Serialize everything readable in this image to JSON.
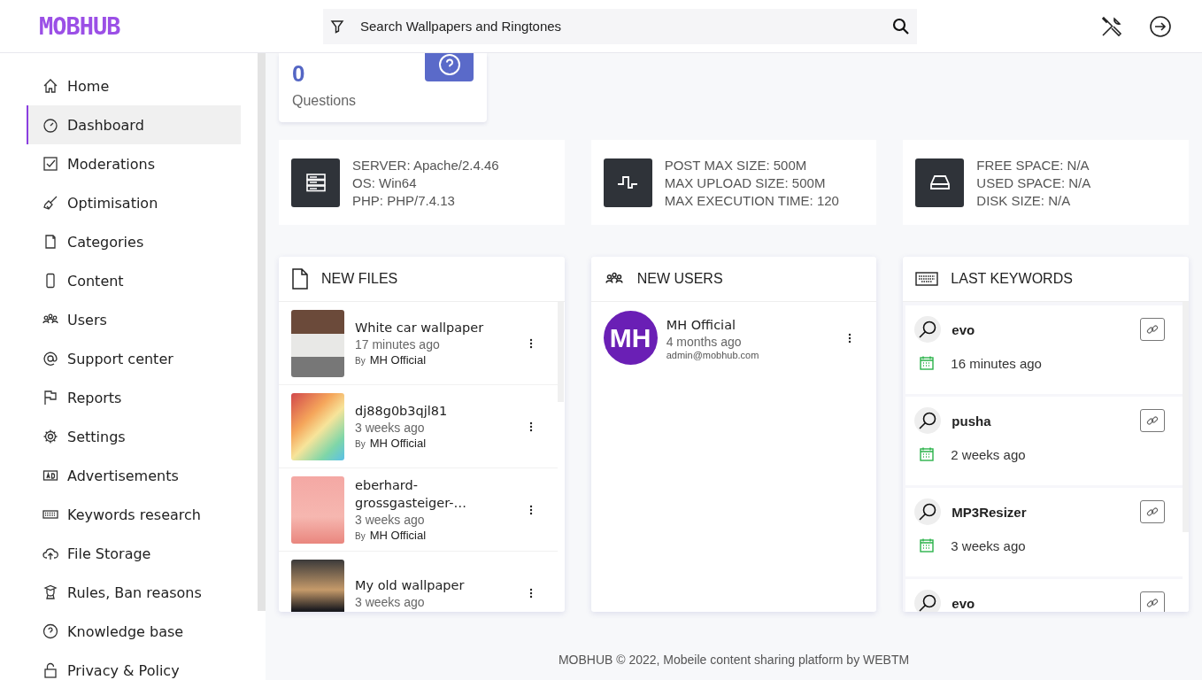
{
  "logo": "MOBHUB",
  "search": {
    "placeholder": "Search Wallpapers and Ringtones"
  },
  "sidebar": {
    "items": [
      {
        "label": "Home",
        "selected": false
      },
      {
        "label": "Dashboard",
        "selected": true
      },
      {
        "label": "Moderations",
        "selected": false
      },
      {
        "label": "Optimisation",
        "selected": false
      },
      {
        "label": "Categories",
        "selected": false
      },
      {
        "label": "Content",
        "selected": false
      },
      {
        "label": "Users",
        "selected": false
      },
      {
        "label": "Support center",
        "selected": false
      },
      {
        "label": "Reports",
        "selected": false
      },
      {
        "label": "Settings",
        "selected": false
      },
      {
        "label": "Advertisements",
        "selected": false
      },
      {
        "label": "Keywords research",
        "selected": false
      },
      {
        "label": "File Storage",
        "selected": false
      },
      {
        "label": "Rules, Ban reasons",
        "selected": false
      },
      {
        "label": "Knowledge base",
        "selected": false
      },
      {
        "label": "Privacy & Policy",
        "selected": false
      }
    ]
  },
  "questions_card": {
    "count": "0",
    "label": "Questions"
  },
  "server_cards": [
    {
      "lines": [
        "SERVER: Apache/2.4.46",
        "OS: Win64",
        "PHP: PHP/7.4.13"
      ]
    },
    {
      "lines": [
        "POST MAX SIZE: 500M",
        "MAX UPLOAD SIZE: 500M",
        "MAX EXECUTION TIME: 120"
      ]
    },
    {
      "lines": [
        "FREE SPACE: N/A",
        "USED SPACE: N/A",
        "DISK SIZE: N/A"
      ]
    }
  ],
  "new_files": {
    "title": "NEW FILES",
    "files": [
      {
        "name": "White car wallpaper",
        "time": "17 minutes ago",
        "by": "By",
        "author": "MH Official"
      },
      {
        "name": "dj88g0b3qjl81",
        "time": "3 weeks ago",
        "by": "By",
        "author": "MH Official"
      },
      {
        "name": "eberhard-grossgasteiger-…",
        "time": "3 weeks ago",
        "by": "By",
        "author": "MH Official"
      },
      {
        "name": "My old wallpaper",
        "time": "3 weeks ago"
      }
    ]
  },
  "new_users": {
    "title": "NEW USERS",
    "users": [
      {
        "initials": "MH",
        "name": "MH Official",
        "time": "4 months ago",
        "email": "admin@mobhub.com"
      }
    ]
  },
  "last_keywords": {
    "title": "LAST KEYWORDS",
    "keywords": [
      {
        "keyword": "evo",
        "time": "16 minutes ago"
      },
      {
        "keyword": "pusha",
        "time": "2 weeks ago"
      },
      {
        "keyword": "MP3Resizer",
        "time": "3 weeks ago"
      },
      {
        "keyword": "evo"
      }
    ]
  },
  "footer": "MOBHUB © 2022, Mobeile content sharing platform by WEBTM"
}
